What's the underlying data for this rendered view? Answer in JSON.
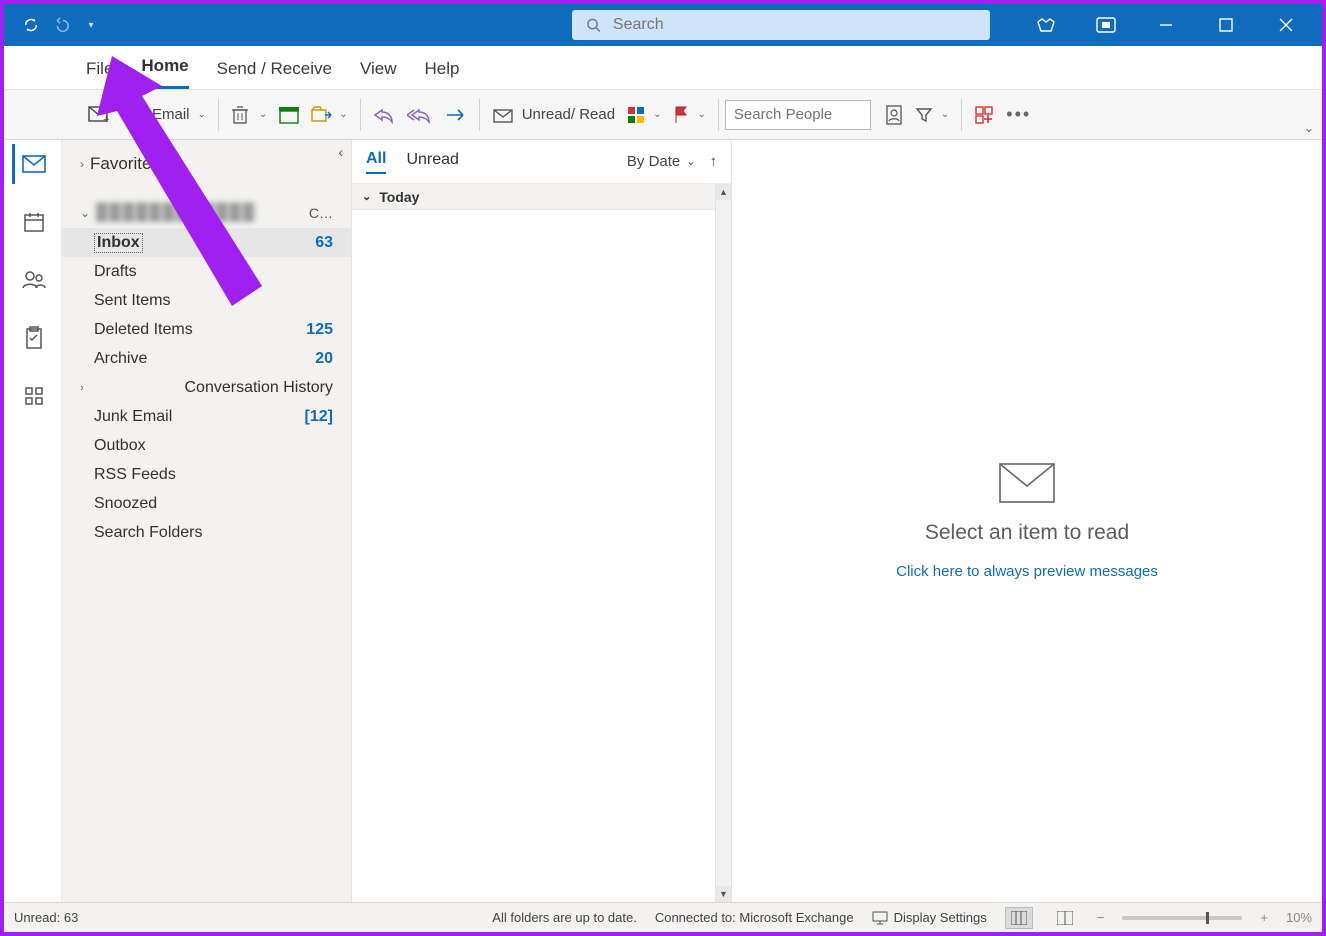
{
  "titlebar": {
    "search_placeholder": "Search"
  },
  "tabs": {
    "file": "File",
    "home": "Home",
    "send_receive": "Send / Receive",
    "view": "View",
    "help": "Help"
  },
  "ribbon": {
    "new_email_label": "Email",
    "unread_read": "Unread/ Read",
    "search_people_placeholder": "Search People"
  },
  "folder_pane": {
    "favorites": "Favorites",
    "account_suffix": "C…",
    "folders": [
      {
        "name": "Inbox",
        "count": "63",
        "selected": true
      },
      {
        "name": "Drafts",
        "count": ""
      },
      {
        "name": "Sent Items",
        "count": ""
      },
      {
        "name": "Deleted Items",
        "count": "125"
      },
      {
        "name": "Archive",
        "count": "20"
      },
      {
        "name": "Conversation History",
        "count": "",
        "expandable": true
      },
      {
        "name": "Junk Email",
        "count": "[12]"
      },
      {
        "name": "Outbox",
        "count": ""
      },
      {
        "name": "RSS Feeds",
        "count": ""
      },
      {
        "name": "Snoozed",
        "count": ""
      },
      {
        "name": "Search Folders",
        "count": ""
      }
    ]
  },
  "message_list": {
    "tab_all": "All",
    "tab_unread": "Unread",
    "sort": "By Date",
    "group": "Today"
  },
  "reading_pane": {
    "headline": "Select an item to read",
    "link": "Click here to always preview messages"
  },
  "status_bar": {
    "unread": "Unread: 63",
    "sync": "All folders are up to date.",
    "conn": "Connected to: Microsoft Exchange",
    "display": "Display Settings",
    "zoom": "10%"
  }
}
